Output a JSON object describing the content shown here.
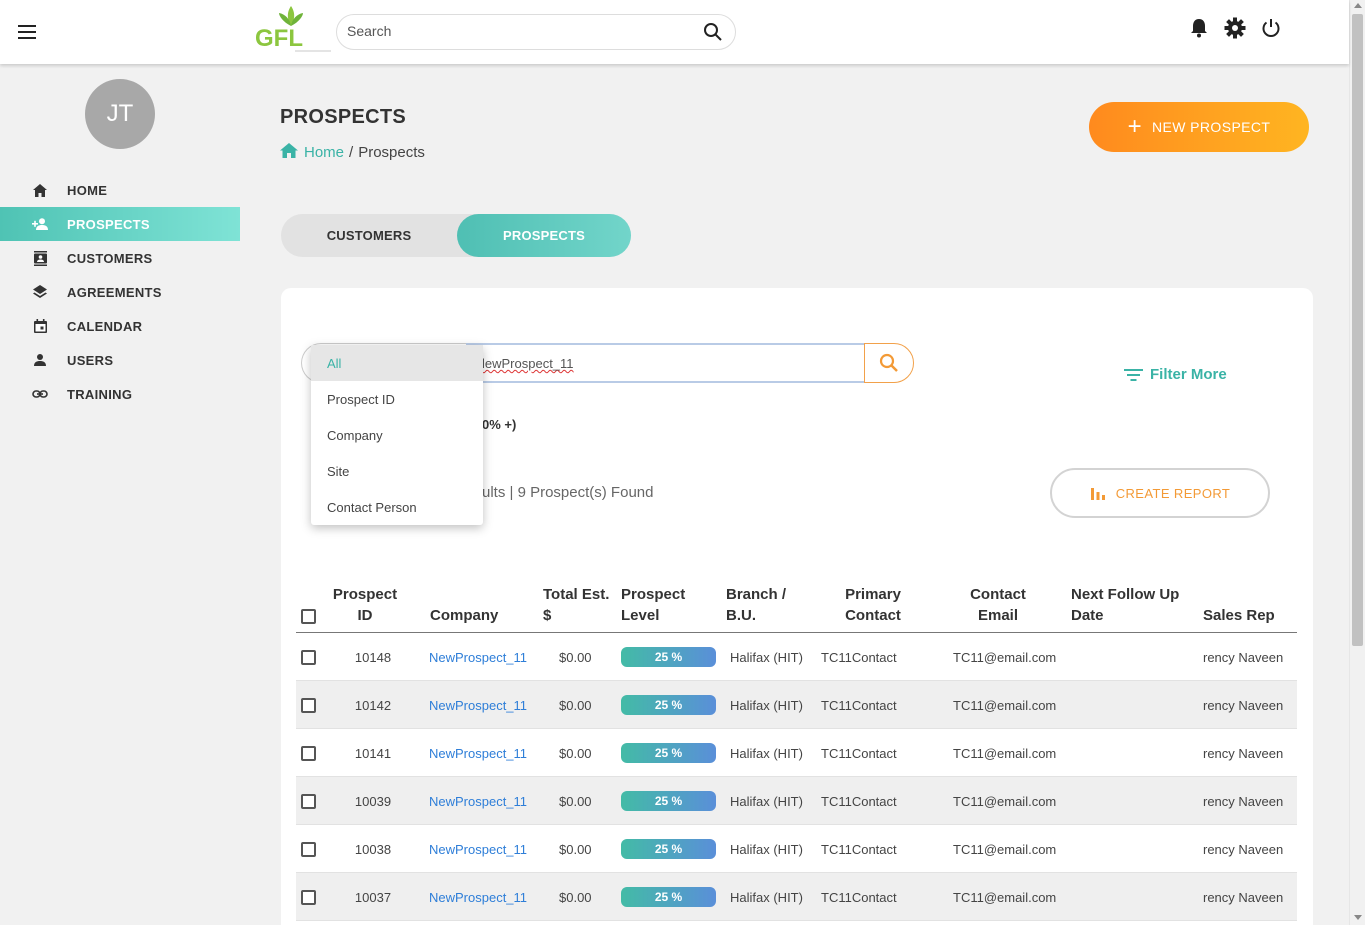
{
  "topbar": {
    "logo_text": "GFL",
    "search_placeholder": "Search"
  },
  "sidebar": {
    "avatar_initials": "JT",
    "items": [
      {
        "label": "HOME",
        "icon": "home-icon"
      },
      {
        "label": "PROSPECTS",
        "icon": "add-person-icon",
        "active": true
      },
      {
        "label": "CUSTOMERS",
        "icon": "contact-card-icon"
      },
      {
        "label": "AGREEMENTS",
        "icon": "layers-icon"
      },
      {
        "label": "CALENDAR",
        "icon": "calendar-icon"
      },
      {
        "label": "USERS",
        "icon": "person-icon"
      },
      {
        "label": "TRAINING",
        "icon": "link-icon"
      }
    ]
  },
  "header": {
    "title": "PROSPECTS",
    "breadcrumb_home": "Home",
    "breadcrumb_sep": "/",
    "breadcrumb_current": "Prospects",
    "new_button_label": "NEW PROSPECT"
  },
  "toggle": {
    "customers_label": "CUSTOMERS",
    "prospects_label": "PROSPECTS",
    "active": "PROSPECTS"
  },
  "search": {
    "value": "NewProspect_11",
    "visible_value": "lewProspect_11",
    "filter_more_label": "Filter More",
    "level_fragment": "0% +)",
    "results_fragment": "ults | 9 Prospect(s) Found",
    "report_button_label": "CREATE REPORT"
  },
  "dropdown": {
    "options": [
      "All",
      "Prospect ID",
      "Company",
      "Site",
      "Contact Person"
    ],
    "selected": "All"
  },
  "table": {
    "columns": {
      "id": [
        "Prospect",
        "ID"
      ],
      "company": "Company",
      "total": [
        "Total Est.",
        "$"
      ],
      "level": [
        "Prospect",
        "Level"
      ],
      "branch": [
        "Branch /",
        "B.U."
      ],
      "contact": [
        "Primary",
        "Contact"
      ],
      "email": [
        "Contact",
        "Email"
      ],
      "followup": [
        "Next Follow Up",
        "Date"
      ],
      "rep": "Sales Rep"
    },
    "rows": [
      {
        "id": "10148",
        "company": "NewProspect_11",
        "total": "$0.00",
        "level": "25 %",
        "branch": "Halifax (HIT)",
        "contact": "TC11Contact",
        "email": "TC11@email.com",
        "followup": "",
        "rep": "rency Naveen"
      },
      {
        "id": "10142",
        "company": "NewProspect_11",
        "total": "$0.00",
        "level": "25 %",
        "branch": "Halifax (HIT)",
        "contact": "TC11Contact",
        "email": "TC11@email.com",
        "followup": "",
        "rep": "rency Naveen"
      },
      {
        "id": "10141",
        "company": "NewProspect_11",
        "total": "$0.00",
        "level": "25 %",
        "branch": "Halifax (HIT)",
        "contact": "TC11Contact",
        "email": "TC11@email.com",
        "followup": "",
        "rep": "rency Naveen"
      },
      {
        "id": "10039",
        "company": "NewProspect_11",
        "total": "$0.00",
        "level": "25 %",
        "branch": "Halifax (HIT)",
        "contact": "TC11Contact",
        "email": "TC11@email.com",
        "followup": "",
        "rep": "rency Naveen"
      },
      {
        "id": "10038",
        "company": "NewProspect_11",
        "total": "$0.00",
        "level": "25 %",
        "branch": "Halifax (HIT)",
        "contact": "TC11Contact",
        "email": "TC11@email.com",
        "followup": "",
        "rep": "rency Naveen"
      },
      {
        "id": "10037",
        "company": "NewProspect_11",
        "total": "$0.00",
        "level": "25 %",
        "branch": "Halifax (HIT)",
        "contact": "TC11Contact",
        "email": "TC11@email.com",
        "followup": "",
        "rep": "rency Naveen"
      }
    ]
  },
  "colors": {
    "teal": "#3ab3a6",
    "orange": "#ff8a1e",
    "link_blue": "#2e7ed8",
    "logo_green": "#8cc63f"
  }
}
